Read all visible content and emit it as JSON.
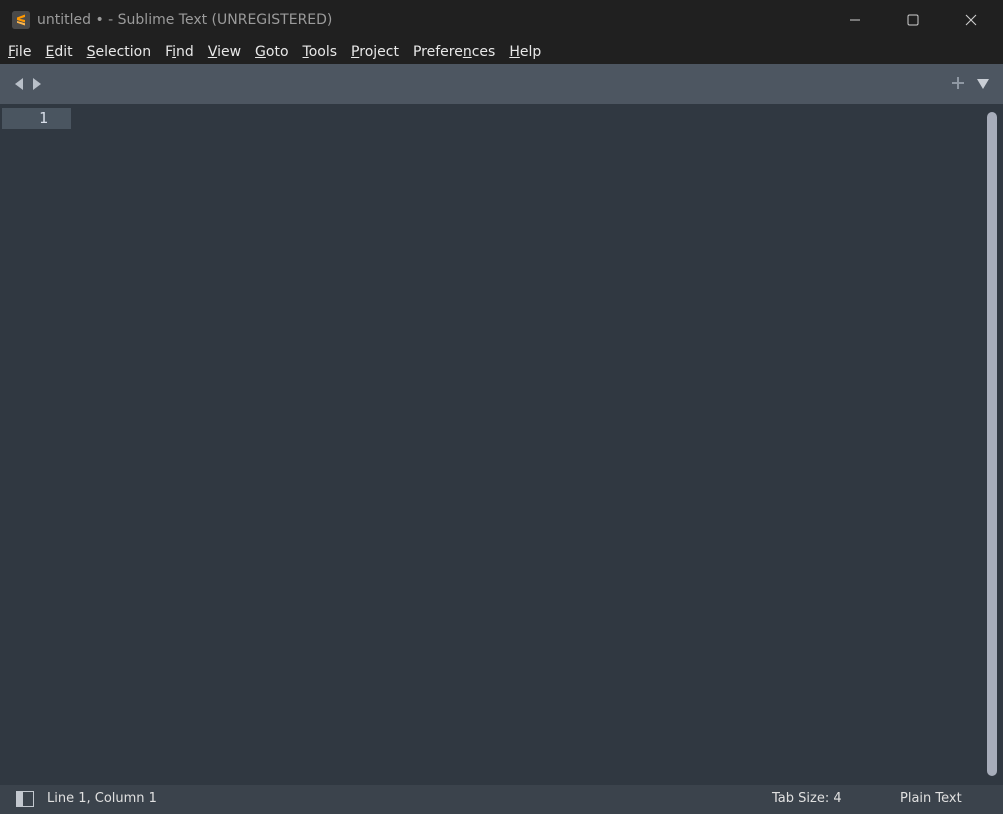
{
  "window": {
    "title": "untitled • - Sublime Text (UNREGISTERED)"
  },
  "menu": [
    {
      "accel": "F",
      "rest": "ile"
    },
    {
      "accel": "E",
      "rest": "dit"
    },
    {
      "accel": "S",
      "rest": "election"
    },
    {
      "pre": "F",
      "accel": "i",
      "rest": "nd"
    },
    {
      "accel": "V",
      "rest": "iew"
    },
    {
      "accel": "G",
      "rest": "oto"
    },
    {
      "accel": "T",
      "rest": "ools"
    },
    {
      "accel": "P",
      "rest": "roject"
    },
    {
      "pre": "Prefere",
      "accel": "n",
      "rest": "ces"
    },
    {
      "accel": "H",
      "rest": "elp"
    }
  ],
  "editor": {
    "line_numbers": [
      "1"
    ]
  },
  "status": {
    "position": "Line 1, Column 1",
    "tab_size": "Tab Size: 4",
    "syntax": "Plain Text"
  },
  "icons": {
    "app": "sublime-text-icon",
    "minimize": "minimize-icon",
    "maximize": "maximize-icon",
    "close": "close-icon",
    "prev": "chevron-left-icon",
    "next": "chevron-right-icon",
    "new_tab": "plus-icon",
    "tab_menu": "chevron-down-icon",
    "sidebar": "sidebar-toggle-icon"
  },
  "colors": {
    "accent": "#f9a825",
    "editor_bg": "#303841",
    "tabbar_bg": "#4d5661"
  }
}
